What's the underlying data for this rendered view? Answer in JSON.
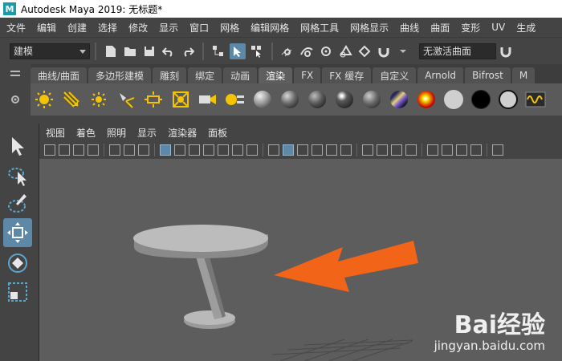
{
  "window": {
    "logo_letter": "M",
    "title": "Autodesk Maya 2019: 无标题*"
  },
  "menubar": {
    "items": [
      "文件",
      "编辑",
      "创建",
      "选择",
      "修改",
      "显示",
      "窗口",
      "网格",
      "编辑网格",
      "网格工具",
      "网格显示",
      "曲线",
      "曲面",
      "变形",
      "UV",
      "生成"
    ]
  },
  "statusline": {
    "mode_value": "建模",
    "object_field": "无激活曲面"
  },
  "shelf": {
    "tabs": [
      "曲线/曲面",
      "多边形建模",
      "雕刻",
      "绑定",
      "动画",
      "渲染",
      "FX",
      "FX 缓存",
      "自定义",
      "Arnold",
      "Bifrost",
      "M"
    ],
    "active_tab": "渲染"
  },
  "panel": {
    "menu": [
      "视图",
      "着色",
      "照明",
      "显示",
      "渲染器",
      "面板"
    ]
  },
  "watermark": {
    "brand": "Bai经验",
    "url": "jingyan.baidu.com"
  },
  "colors": {
    "viewport_bg": "#5d5d5d",
    "active_blue": "#5d88a8",
    "arrow_orange": "#f26418"
  }
}
